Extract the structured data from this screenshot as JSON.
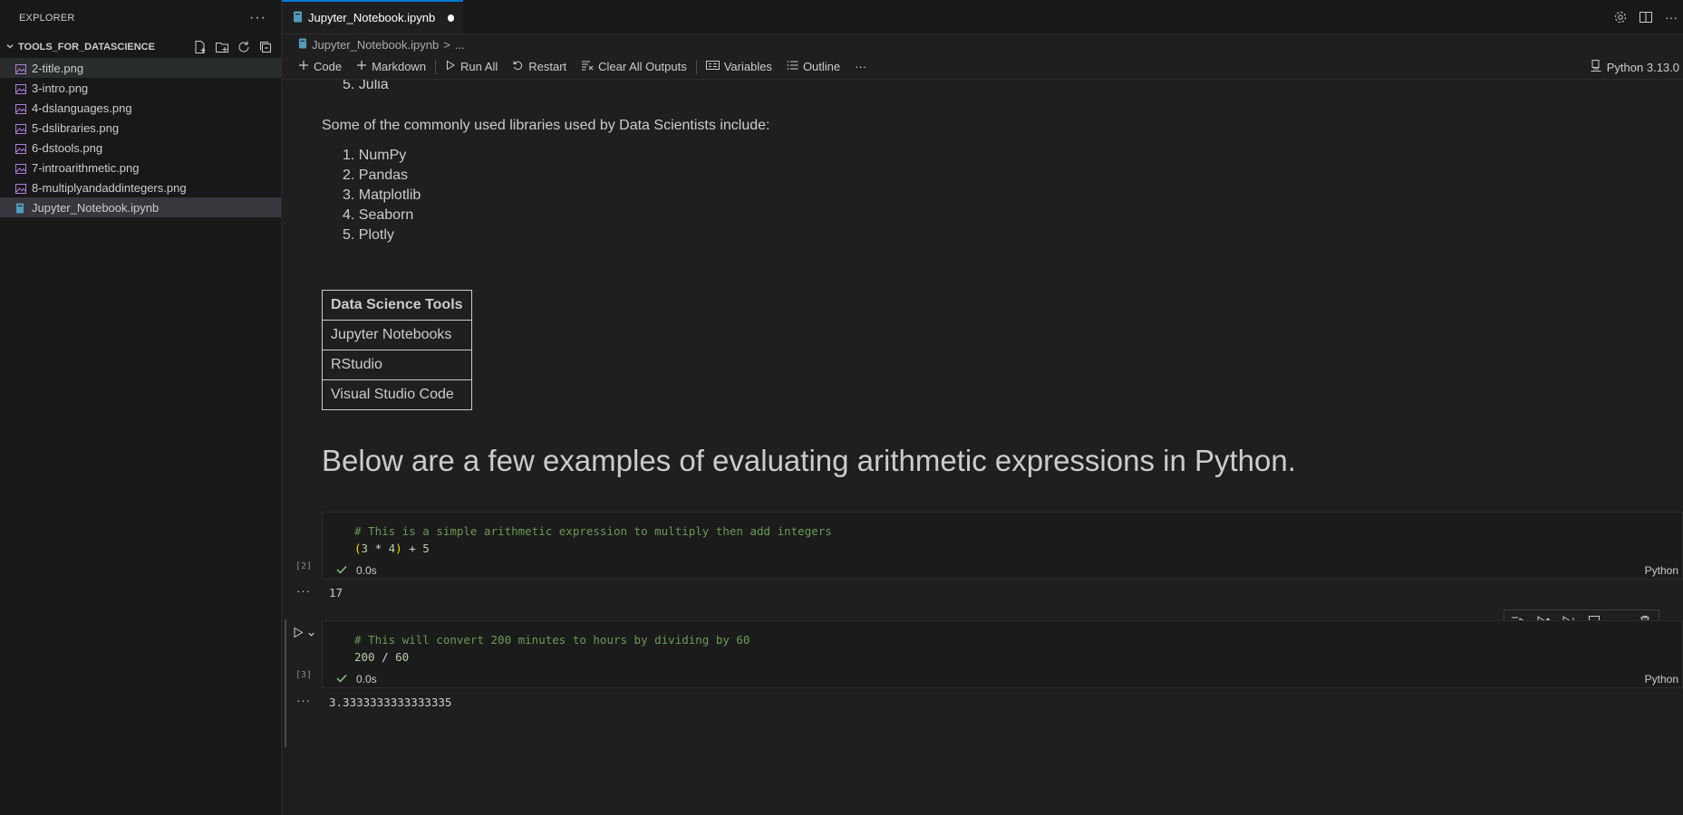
{
  "sidebar": {
    "title": "EXPLORER",
    "more": "···",
    "section": "TOOLS_FOR_DATASCIENCE",
    "files": [
      {
        "name": "2-title.png",
        "type": "image"
      },
      {
        "name": "3-intro.png",
        "type": "image"
      },
      {
        "name": "4-dslanguages.png",
        "type": "image"
      },
      {
        "name": "5-dslibraries.png",
        "type": "image"
      },
      {
        "name": "6-dstools.png",
        "type": "image"
      },
      {
        "name": "7-introarithmetic.png",
        "type": "image"
      },
      {
        "name": "8-multiplyandaddintegers.png",
        "type": "image"
      },
      {
        "name": "Jupyter_Notebook.ipynb",
        "type": "notebook"
      }
    ]
  },
  "tab": {
    "label": "Jupyter_Notebook.ipynb"
  },
  "breadcrumb": {
    "file": "Jupyter_Notebook.ipynb",
    "sep": ">",
    "more": "..."
  },
  "toolbar": {
    "code": "Code",
    "markdown": "Markdown",
    "run_all": "Run All",
    "restart": "Restart",
    "clear": "Clear All Outputs",
    "variables": "Variables",
    "outline": "Outline",
    "more": "···",
    "kernel": "Python 3.13.0"
  },
  "notebook": {
    "languages_tail": "5. Julia",
    "libraries_intro": "Some of the commonly used libraries used by Data Scientists include:",
    "libraries": [
      "1. NumPy",
      "2. Pandas",
      "3. Matplotlib",
      "4. Seaborn",
      "5. Plotly"
    ],
    "tools_table": {
      "header": "Data Science Tools",
      "rows": [
        "Jupyter Notebooks",
        "RStudio",
        "Visual Studio Code"
      ]
    },
    "heading": "Below are a few examples of evaluating arithmetic expressions in Python.",
    "cells": [
      {
        "exec_count": "[2]",
        "comment": "# This is a simple arithmetic expression to multiply then add integers",
        "code_parts": {
          "lp": "(",
          "a": "3",
          "op1": " * ",
          "b": "4",
          "rp": ")",
          "op2": " + ",
          "c": "5"
        },
        "time": "0.0s",
        "lang": "Python",
        "output_more": "···",
        "output": "17"
      },
      {
        "exec_count": "[3]",
        "comment": "# This will convert 200 minutes to hours by dividing by 60",
        "code_parts": {
          "a": "200",
          "op": " / ",
          "b": "60"
        },
        "time": "0.0s",
        "lang": "Python",
        "output_more": "···",
        "output": "3.3333333333333335"
      }
    ]
  },
  "colors": {
    "accent": "#0078d4",
    "success": "#89d185",
    "image_icon": "#b180d7",
    "notebook_icon": "#519aba"
  }
}
